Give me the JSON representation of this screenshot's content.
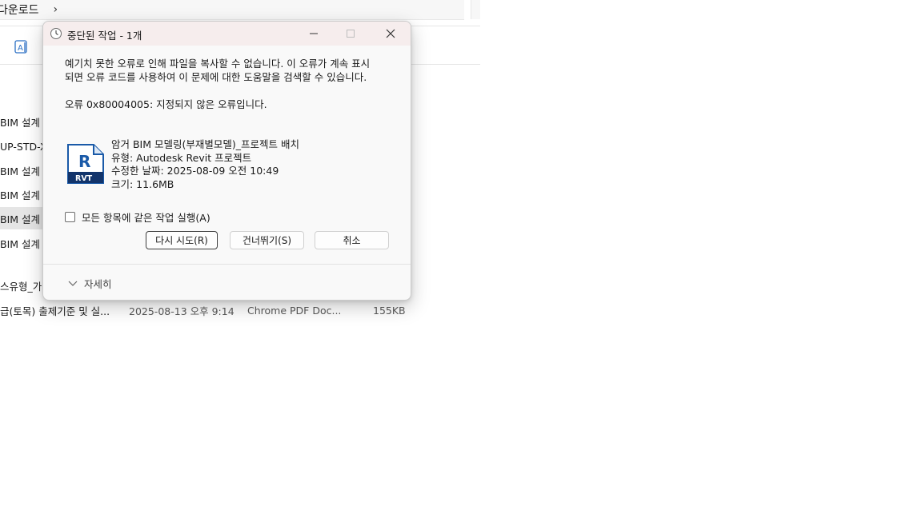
{
  "explorer": {
    "breadcrumb": "다운로드",
    "breadcrumb_sep": "›",
    "rows": [
      {
        "name": "BIM 설계",
        "date": "",
        "type": "",
        "size": ""
      },
      {
        "name": "UP-STD-X",
        "date": "",
        "type": "",
        "size": ""
      },
      {
        "name": "BIM 설계",
        "date": "",
        "type": "",
        "size": ""
      },
      {
        "name": "BIM 설계",
        "date": "",
        "type": "",
        "size": ""
      },
      {
        "name": "BIM 설계",
        "date": "",
        "type": "",
        "size": ""
      },
      {
        "name": "BIM 설계",
        "date": "",
        "type": "",
        "size": ""
      },
      {
        "name": "스유형_가(",
        "date": "",
        "type": "",
        "size": ""
      },
      {
        "name": "급(토목) 출제기준 및 실...",
        "date": "2025-08-13 오후 9:14",
        "type": "Chrome PDF Doc...",
        "size": "155KB"
      }
    ]
  },
  "dialog": {
    "title": "중단된 작업 - 1개",
    "message_line1": "예기치 못한 오류로 인해 파일을 복사할 수 없습니다. 이 오류가 계속 표시",
    "message_line2": "되면 오류 코드를 사용하여 이 문제에 대한 도움말을 검색할 수 있습니다.",
    "error_code": "오류 0x80004005: 지정되지 않은 오류입니다.",
    "file": {
      "icon_letter": "R",
      "icon_badge": "RVT",
      "name": "암거 BIM 모델링(부재별모델)_프로젝트 배치",
      "type": "유형: Autodesk Revit 프로젝트",
      "modified": "수정한 날짜: 2025-08-09 오전 10:49",
      "size": "크기: 11.6MB"
    },
    "apply_all_label": "모든 항목에 같은 작업 실행(A)",
    "buttons": {
      "retry": "다시 시도(R)",
      "skip": "건너뛰기(S)",
      "cancel": "취소"
    },
    "details_label": "자세히"
  },
  "colors": {
    "titlebar": "#f6eded",
    "revit_blue": "#1a5aa8",
    "revit_dark": "#12346b"
  }
}
